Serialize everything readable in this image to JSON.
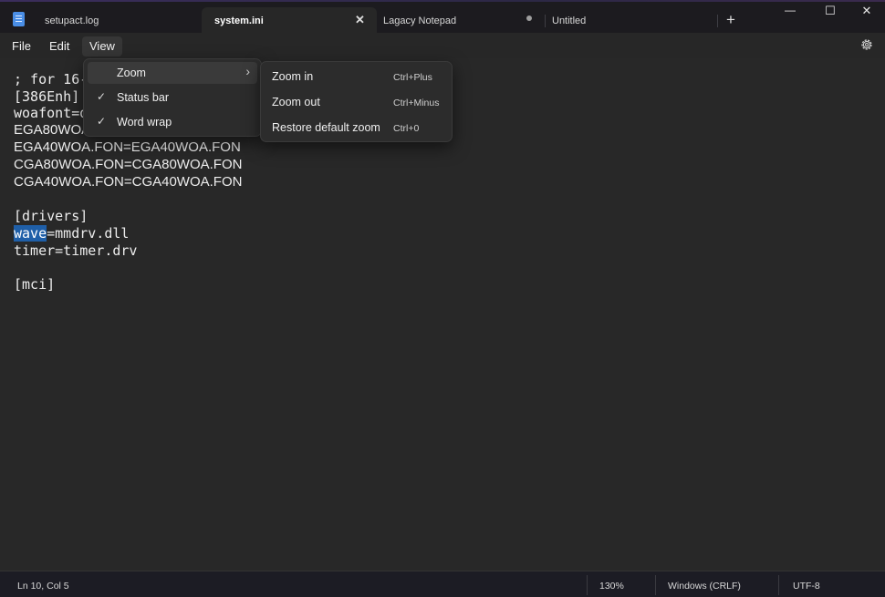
{
  "tabs": [
    {
      "label": "setupact.log"
    },
    {
      "label": "system.ini",
      "close": "✕"
    },
    {
      "label": "Lagacy Notepad"
    },
    {
      "label": "Untitled"
    }
  ],
  "new_tab": "+",
  "window": {
    "minimize": "—",
    "maximize": "☐",
    "close": "✕"
  },
  "menu": {
    "file": "File",
    "edit": "Edit",
    "view": "View"
  },
  "editor": {
    "lines": [
      "; for 16-",
      "[386Enh]",
      "woafont=d",
      "EGA80WOA.",
      "EGA40WOA.FON=EGA40WOA.FON",
      "CGA80WOA.FON=CGA80WOA.FON",
      "CGA40WOA.FON=CGA40WOA.FON",
      "",
      "[drivers]",
      "mmdrv.dll",
      "timer=timer.drv",
      "",
      "[mci]"
    ],
    "selected_word": "wave",
    "after_selection": "=mmdrv.dll"
  },
  "view_menu": {
    "zoom": "Zoom",
    "status_bar": "Status bar",
    "word_wrap": "Word wrap",
    "check": "✓",
    "chevron": "›"
  },
  "zoom_menu": [
    {
      "label": "Zoom in",
      "accel": "Ctrl+Plus"
    },
    {
      "label": "Zoom out",
      "accel": "Ctrl+Minus"
    },
    {
      "label": "Restore default zoom",
      "accel": "Ctrl+0"
    }
  ],
  "status": {
    "position": "Ln 10, Col 5",
    "zoom": "130%",
    "line_ending": "Windows (CRLF)",
    "encoding": "UTF-8"
  }
}
